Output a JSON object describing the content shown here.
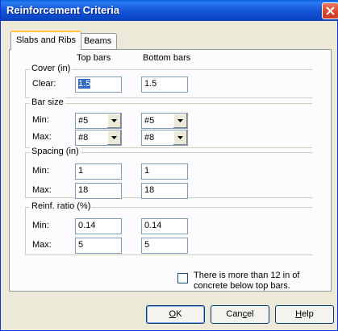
{
  "window": {
    "title": "Reinforcement Criteria"
  },
  "tabs": [
    {
      "label": "Slabs and Ribs",
      "active": true
    },
    {
      "label": "Beams",
      "active": false
    }
  ],
  "columns": {
    "top": "Top bars",
    "bottom": "Bottom bars"
  },
  "cover": {
    "legend": "Cover (in)",
    "clear_label": "Clear:",
    "top_value": "1.5",
    "bottom_value": "1.5"
  },
  "bar_size": {
    "legend": "Bar size",
    "min_label": "Min:",
    "max_label": "Max:",
    "top_min": "#5",
    "bottom_min": "#5",
    "top_max": "#8",
    "bottom_max": "#8"
  },
  "spacing": {
    "legend": "Spacing (in)",
    "min_label": "Min:",
    "max_label": "Max:",
    "top_min": "1",
    "bottom_min": "1",
    "top_max": "18",
    "bottom_max": "18"
  },
  "reinf_ratio": {
    "legend": "Reinf. ratio (%)",
    "min_label": "Min:",
    "max_label": "Max:",
    "top_min": "0.14",
    "bottom_min": "0.14",
    "top_max": "5",
    "bottom_max": "5"
  },
  "concrete_check": {
    "line1": "There is more than 12 in of",
    "line2": "concrete below top bars.",
    "checked": false
  },
  "buttons": {
    "ok_accel": "O",
    "ok_rest": "K",
    "cancel_pre": "Can",
    "cancel_accel": "c",
    "cancel_rest": "el",
    "help_accel": "H",
    "help_rest": "elp"
  },
  "colors": {
    "titlebar": "#0c47c8",
    "close": "#d9442a",
    "face": "#ece9d8"
  }
}
